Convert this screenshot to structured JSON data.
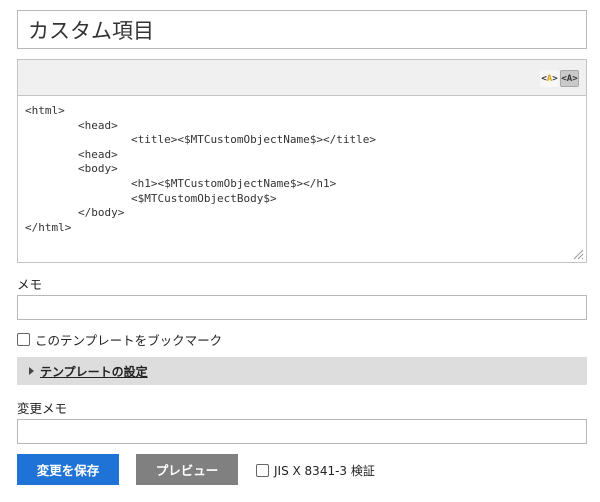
{
  "title_field": {
    "value": "カスタム項目"
  },
  "editor": {
    "toolbar": {
      "btn1_label": "A",
      "btn2_label": "A"
    },
    "code": "<html>\n\t<head>\n\t\t<title><$MTCustomObjectName$></title>\n\t<head>\n\t<body>\n\t\t<h1><$MTCustomObjectName$></h1>\n\t\t<$MTCustomObjectBody$>\n\t</body>\n</html>"
  },
  "memo": {
    "label": "メモ",
    "value": ""
  },
  "bookmark": {
    "label": "このテンプレートをブックマーク"
  },
  "settings": {
    "label": "テンプレートの設定"
  },
  "change_memo": {
    "label": "変更メモ",
    "value": ""
  },
  "actions": {
    "save_label": "変更を保存",
    "preview_label": "プレビュー",
    "jis_label": "JIS X 8341-3 検証"
  }
}
